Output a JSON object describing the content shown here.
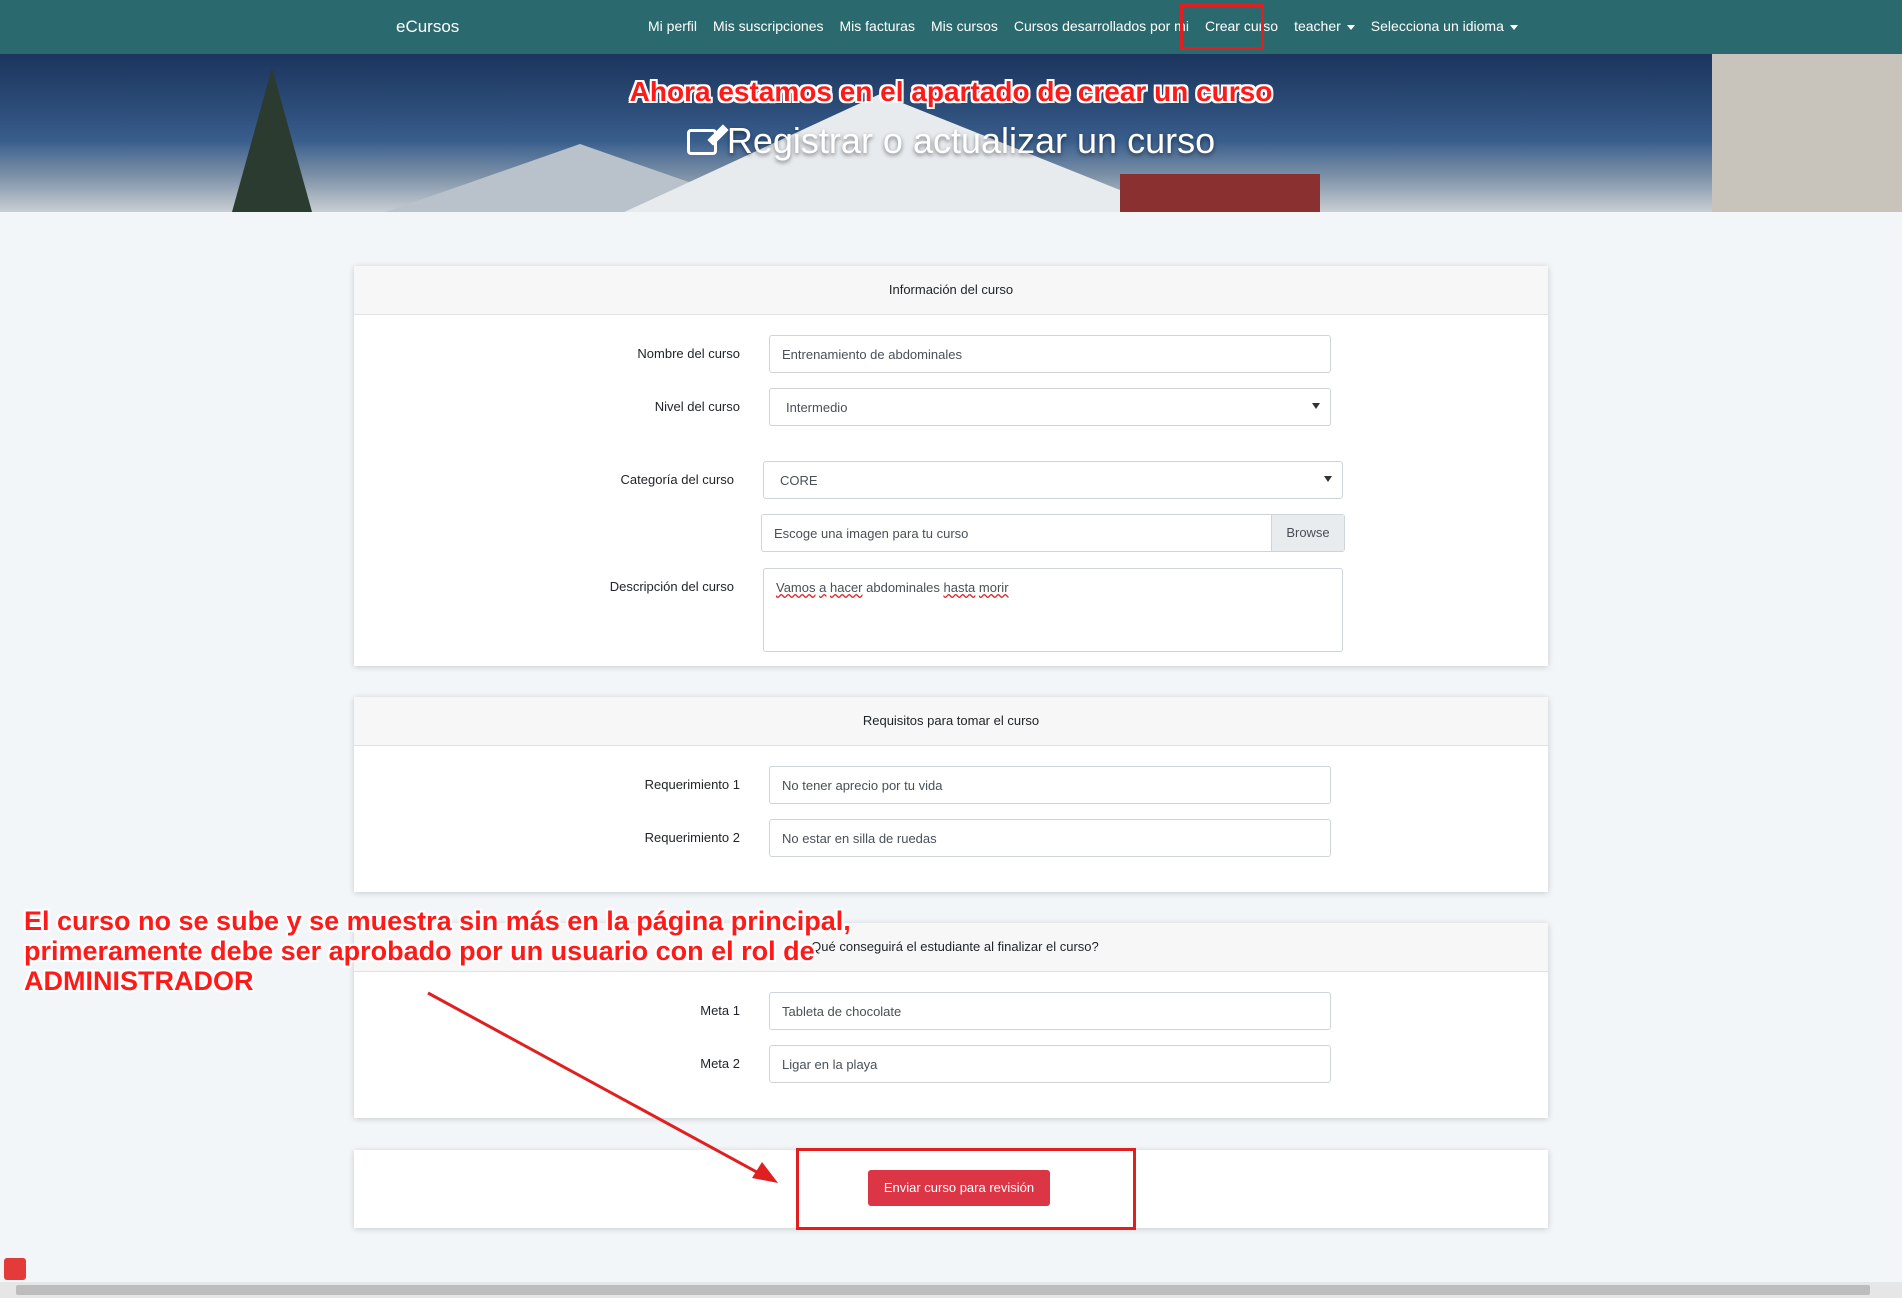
{
  "navbar": {
    "brand": "eCursos",
    "items": [
      {
        "label": "Mi perfil"
      },
      {
        "label": "Mis suscripciones"
      },
      {
        "label": "Mis facturas"
      },
      {
        "label": "Mis cursos"
      },
      {
        "label": "Cursos desarrollados por mi"
      },
      {
        "label": "Crear curso"
      },
      {
        "label": "teacher"
      },
      {
        "label": "Selecciona un idioma"
      }
    ]
  },
  "hero": {
    "annotation": "Ahora estamos en el apartado de crear un curso",
    "title": "Registrar o actualizar un curso"
  },
  "course_info": {
    "header": "Información del curso",
    "name_label": "Nombre del curso",
    "name_value": "Entrenamiento de abdominales",
    "level_label": "Nivel del curso",
    "level_value": "Intermedio",
    "category_label": "Categoría del curso",
    "category_value": "CORE",
    "image_placeholder": "Escoge una imagen para tu curso",
    "browse_label": "Browse",
    "description_label": "Descripción del curso",
    "description_words": [
      "Vamos",
      "a",
      "hacer",
      "abdominales",
      "hasta",
      "morir"
    ]
  },
  "requirements": {
    "header": "Requisitos para tomar el curso",
    "items": [
      {
        "label": "Requerimiento 1",
        "value": "No tener aprecio por tu vida"
      },
      {
        "label": "Requerimiento 2",
        "value": "No estar en silla de ruedas"
      }
    ]
  },
  "goals": {
    "header": "¿Qué conseguirá el estudiante al finalizar el curso?",
    "items": [
      {
        "label": "Meta 1",
        "value": "Tableta de chocolate"
      },
      {
        "label": "Meta 2",
        "value": "Ligar en la playa"
      }
    ]
  },
  "submit": {
    "label": "Enviar curso para revisión"
  },
  "annotation_bottom": {
    "lines": [
      "El curso no se sube y se muestra sin más en la página principal,",
      "primeramente debe ser aprobado por un usuario con el rol de",
      "ADMINISTRADOR"
    ]
  },
  "colors": {
    "navbar": "#2a6a6f",
    "annotation": "#ff1a1a",
    "submit": "#dc3545"
  }
}
